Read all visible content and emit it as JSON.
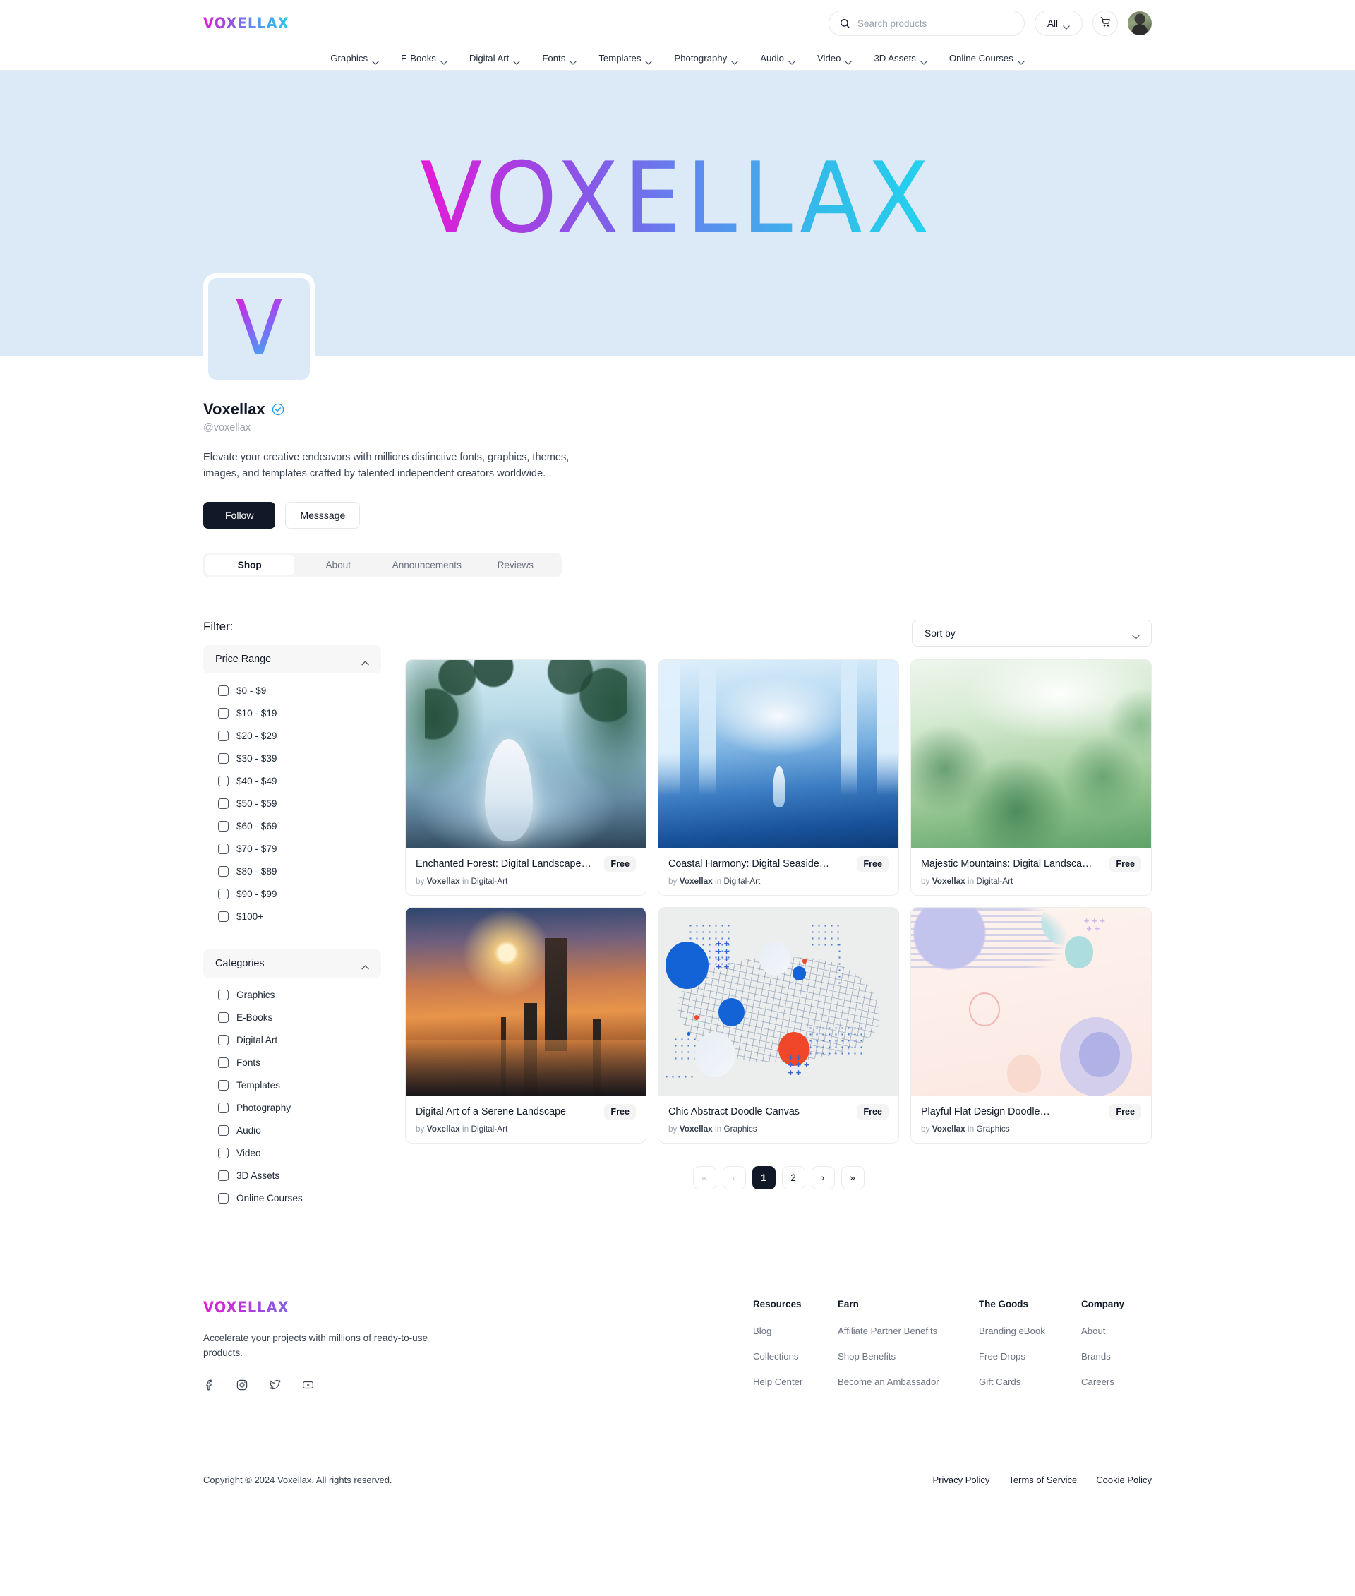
{
  "header": {
    "brand": "VOXELLAX",
    "search": {
      "placeholder": "Search products",
      "value": "",
      "scope": "All"
    },
    "icons": {
      "search": "search-icon",
      "cart": "cart-icon",
      "avatar": "user-avatar"
    }
  },
  "nav": {
    "items": [
      {
        "label": "Graphics"
      },
      {
        "label": "E-Books"
      },
      {
        "label": "Digital Art"
      },
      {
        "label": "Fonts"
      },
      {
        "label": "Templates"
      },
      {
        "label": "Photography"
      },
      {
        "label": "Audio"
      },
      {
        "label": "Video"
      },
      {
        "label": "3D Assets"
      },
      {
        "label": "Online Courses"
      }
    ]
  },
  "hero": {
    "banner_word": "VOXELLAX",
    "background_color": "#dce9f7"
  },
  "profile": {
    "logo_letter": "V",
    "name": "Voxellax",
    "handle": "@voxellax",
    "verified": true,
    "bio": "Elevate your creative endeavors with millions distinctive fonts, graphics, themes, images, and templates crafted by talented independent creators worldwide.",
    "follow_label": "Follow",
    "message_label": "Messsage",
    "tabs": [
      {
        "label": "Shop",
        "active": true
      },
      {
        "label": "About",
        "active": false
      },
      {
        "label": "Announcements",
        "active": false
      },
      {
        "label": "Reviews",
        "active": false
      }
    ]
  },
  "filters": {
    "title": "Filter:",
    "groups": [
      {
        "name": "Price Range",
        "expanded": true,
        "options": [
          "$0 - $9",
          "$10 - $19",
          "$20 - $29",
          "$30 - $39",
          "$40 - $49",
          "$50 - $59",
          "$60 - $69",
          "$70 - $79",
          "$80 - $89",
          "$90 - $99",
          "$100+"
        ]
      },
      {
        "name": "Categories",
        "expanded": true,
        "options": [
          "Graphics",
          "E-Books",
          "Digital Art",
          "Fonts",
          "Templates",
          "Photography",
          "Audio",
          "Video",
          "3D Assets",
          "Online Courses"
        ]
      }
    ]
  },
  "sort": {
    "label": "Sort by"
  },
  "products": [
    {
      "title": "Enchanted Forest: Digital Landscape…",
      "price": "Free",
      "by_prefix": "by",
      "seller": "Voxellax",
      "in_word": "in",
      "category": "Digital-Art",
      "art": "art-forest"
    },
    {
      "title": "Coastal Harmony: Digital Seaside…",
      "price": "Free",
      "by_prefix": "by",
      "seller": "Voxellax",
      "in_word": "in",
      "category": "Digital-Art",
      "art": "art-coastal"
    },
    {
      "title": "Majestic Mountains: Digital Landsca…",
      "price": "Free",
      "by_prefix": "by",
      "seller": "Voxellax",
      "in_word": "in",
      "category": "Digital-Art",
      "art": "art-mountains"
    },
    {
      "title": "Digital Art of a Serene Landscape",
      "price": "Free",
      "by_prefix": "by",
      "seller": "Voxellax",
      "in_word": "in",
      "category": "Digital-Art",
      "art": "art-bigben"
    },
    {
      "title": "Chic Abstract Doodle Canvas",
      "price": "Free",
      "by_prefix": "by",
      "seller": "Voxellax",
      "in_word": "in",
      "category": "Graphics",
      "art": "art-doodle"
    },
    {
      "title": "Playful Flat Design Doodle…",
      "price": "Free",
      "by_prefix": "by",
      "seller": "Voxellax",
      "in_word": "in",
      "category": "Graphics",
      "art": "art-flat"
    }
  ],
  "pagination": {
    "first": "«",
    "prev": "‹",
    "next": "›",
    "last": "»",
    "pages": [
      {
        "label": "1",
        "active": true
      },
      {
        "label": "2",
        "active": false
      }
    ]
  },
  "footer": {
    "logo": "VOXELLAX",
    "tagline": "Accelerate your projects with millions of ready-to-use products.",
    "socials": [
      "facebook-icon",
      "instagram-icon",
      "twitter-icon",
      "youtube-icon"
    ],
    "columns": [
      {
        "heading": "Resources",
        "links": [
          "Blog",
          "Collections",
          "Help Center"
        ]
      },
      {
        "heading": "Earn",
        "links": [
          "Affiliate Partner Benefits",
          "Shop Benefits",
          "Become an Ambassador"
        ]
      },
      {
        "heading": "The Goods",
        "links": [
          "Branding eBook",
          "Free Drops",
          "Gift Cards"
        ]
      },
      {
        "heading": "Company",
        "links": [
          "About",
          "Brands",
          "Careers"
        ]
      }
    ],
    "copyright": "Copyright © 2024 Voxellax. All rights reserved.",
    "legal": [
      "Privacy Policy",
      "Terms of Service",
      "Cookie Policy"
    ]
  },
  "colors": {
    "brand_start": "#e619d6",
    "brand_end": "#22d3ee",
    "hero_bg": "#dce9f7",
    "dark": "#111827",
    "verified_blue": "#1d9bf0"
  }
}
